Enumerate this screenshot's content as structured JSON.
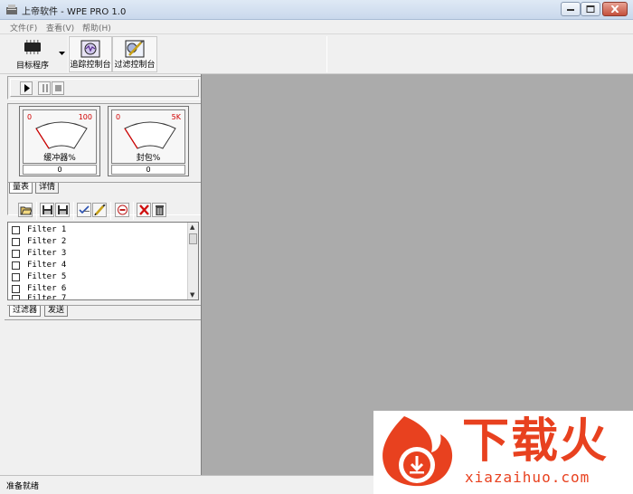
{
  "window": {
    "title": "上帝软件 - WPE PRO 1.0"
  },
  "menu": [
    "文件(F)",
    "查看(V)",
    "帮助(H)"
  ],
  "toolbar": {
    "target_label": "目标程序",
    "trace_console_label": "追踪控制台",
    "filter_console_label": "过滤控制台"
  },
  "gauges": [
    {
      "label": "缓冲器%",
      "min": "0",
      "max": "100",
      "value": "0"
    },
    {
      "label": "封包%",
      "min": "0",
      "max": "5K",
      "value": "0"
    }
  ],
  "gauge_tabs": [
    "量表",
    "详情"
  ],
  "filters": [
    "Filter 1",
    "Filter 2",
    "Filter 3",
    "Filter 4",
    "Filter 5",
    "Filter 6",
    "Filter 7"
  ],
  "filter_tabs": [
    "过滤器",
    "发送"
  ],
  "status": "准备就绪",
  "watermark": {
    "brand": "下载火",
    "domain": "xiazaihuo.com"
  },
  "colors": {
    "gauge_range": "#d00000",
    "main_background": "#ababab",
    "watermark": "#e8411f"
  }
}
